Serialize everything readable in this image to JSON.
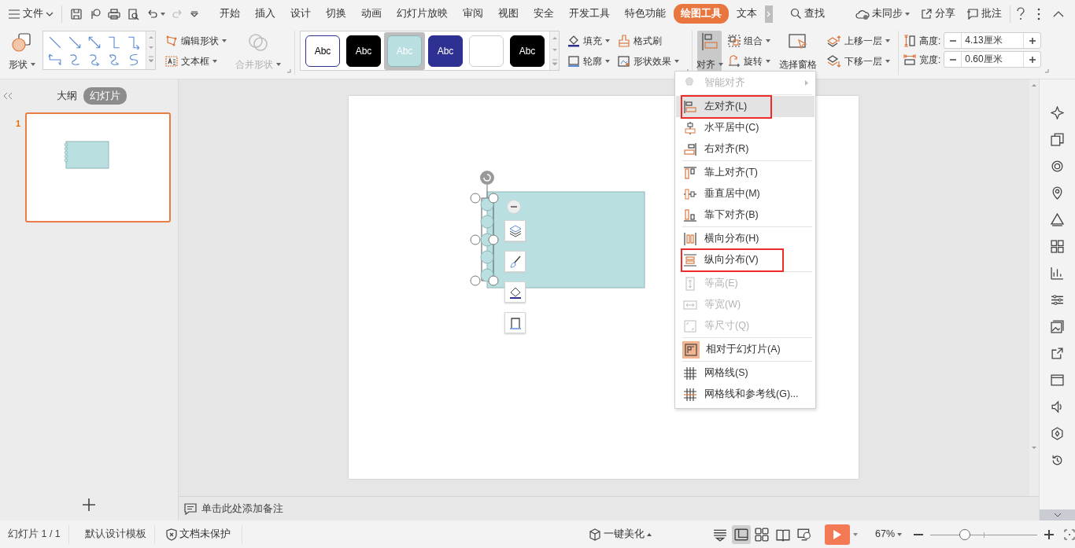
{
  "menu_bar": {
    "file": "文件",
    "tabs": [
      {
        "label": "开始",
        "selected": false
      },
      {
        "label": "插入",
        "selected": false
      },
      {
        "label": "设计",
        "selected": false
      },
      {
        "label": "切换",
        "selected": false
      },
      {
        "label": "动画",
        "selected": false
      },
      {
        "label": "幻灯片放映",
        "selected": false
      },
      {
        "label": "审阅",
        "selected": false
      },
      {
        "label": "视图",
        "selected": false
      },
      {
        "label": "安全",
        "selected": false
      },
      {
        "label": "开发工具",
        "selected": false
      },
      {
        "label": "特色功能",
        "selected": false
      },
      {
        "label": "绘图工具",
        "selected": true
      },
      {
        "label": "文本",
        "selected": false
      }
    ],
    "search": "查找",
    "sync": "未同步",
    "share": "分享",
    "comments": "批注"
  },
  "ribbon": {
    "shape": "形状",
    "edit_shape": "编辑形状",
    "text_box": "文本框",
    "merge_shapes": {
      "label": "合并形状",
      "disabled": true
    },
    "styles": [
      {
        "label": "Abc",
        "color": "#ffffff",
        "selected": false
      },
      {
        "label": "Abc",
        "color": "#000000",
        "selected": false
      },
      {
        "label": "Abc",
        "color": "#b9dfe1",
        "selected": true
      },
      {
        "label": "Abc",
        "color": "#2e3192",
        "selected": false
      },
      {
        "color": "#ffffff",
        "selected": false
      },
      {
        "label": "Abc",
        "color": "#000000",
        "selected": false
      }
    ],
    "fill": "填充",
    "format_painter": "格式刷",
    "outline": "轮廓",
    "shape_effects": "形状效果",
    "align": {
      "label": "对齐",
      "expanded": true
    },
    "group": "组合",
    "rotate": "旋转",
    "selection_pane": "选择窗格",
    "bring_forward": "上移一层",
    "send_backward": "下移一层",
    "height": {
      "label": "高度:",
      "value": "4.13厘米"
    },
    "width": {
      "label": "宽度:",
      "value": "0.60厘米"
    }
  },
  "slide_panel": {
    "tabs": [
      {
        "label": "大纲",
        "selected": false
      },
      {
        "label": "幻灯片",
        "selected": true
      }
    ],
    "slides": [
      {
        "number": "1",
        "selected": true
      }
    ]
  },
  "align_menu": {
    "items": [
      {
        "kind": "item",
        "label": "智能对齐",
        "disabled": true,
        "submenu": true,
        "selected": false,
        "marked": false,
        "checked": false
      },
      {
        "kind": "divider"
      },
      {
        "kind": "item",
        "label": "左对齐(L)",
        "disabled": false,
        "submenu": false,
        "selected": true,
        "marked": true,
        "checked": false
      },
      {
        "kind": "item",
        "label": "水平居中(C)",
        "disabled": false,
        "submenu": false,
        "selected": false,
        "marked": false,
        "checked": false
      },
      {
        "kind": "item",
        "label": "右对齐(R)",
        "disabled": false,
        "submenu": false,
        "selected": false,
        "marked": false,
        "checked": false
      },
      {
        "kind": "divider"
      },
      {
        "kind": "item",
        "label": "靠上对齐(T)",
        "disabled": false,
        "submenu": false,
        "selected": false,
        "marked": false,
        "checked": false
      },
      {
        "kind": "item",
        "label": "垂直居中(M)",
        "disabled": false,
        "submenu": false,
        "selected": false,
        "marked": false,
        "checked": false
      },
      {
        "kind": "item",
        "label": "靠下对齐(B)",
        "disabled": false,
        "submenu": false,
        "selected": false,
        "marked": false,
        "checked": false
      },
      {
        "kind": "divider"
      },
      {
        "kind": "item",
        "label": "横向分布(H)",
        "disabled": false,
        "submenu": false,
        "selected": false,
        "marked": false,
        "checked": false
      },
      {
        "kind": "item",
        "label": "纵向分布(V)",
        "disabled": false,
        "submenu": false,
        "selected": false,
        "marked": true,
        "checked": false
      },
      {
        "kind": "divider"
      },
      {
        "kind": "item",
        "label": "等高(E)",
        "disabled": true,
        "submenu": false,
        "selected": false,
        "marked": false,
        "checked": false
      },
      {
        "kind": "item",
        "label": "等宽(W)",
        "disabled": true,
        "submenu": false,
        "selected": false,
        "marked": false,
        "checked": false
      },
      {
        "kind": "item",
        "label": "等尺寸(Q)",
        "disabled": true,
        "submenu": false,
        "selected": false,
        "marked": false,
        "checked": false
      },
      {
        "kind": "divider"
      },
      {
        "kind": "item",
        "label": "相对于幻灯片(A)",
        "disabled": false,
        "submenu": false,
        "selected": false,
        "marked": false,
        "checked": true
      },
      {
        "kind": "divider"
      },
      {
        "kind": "item",
        "label": "网格线(S)",
        "disabled": false,
        "submenu": false,
        "selected": false,
        "marked": false,
        "checked": false
      },
      {
        "kind": "item",
        "label": "网格线和参考线(G)...",
        "disabled": false,
        "submenu": false,
        "selected": false,
        "marked": false,
        "checked": false
      }
    ]
  },
  "notes_hint": "单击此处添加备注",
  "status_bar": {
    "slide_count": "幻灯片 1 / 1",
    "template": "默认设计模板",
    "protection": "文档未保护",
    "beautify": "一键美化",
    "views": [
      {
        "selected": false
      },
      {
        "selected": true
      },
      {
        "selected": false
      },
      {
        "selected": false
      },
      {
        "selected": false
      }
    ],
    "zoom": "67%",
    "zoom_slider": {
      "level": 0.32
    }
  }
}
